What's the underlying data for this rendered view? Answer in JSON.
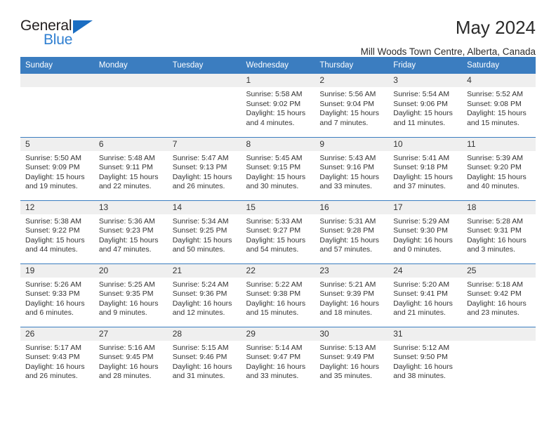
{
  "brand": {
    "name_top": "General",
    "name_bottom": "Blue",
    "triangle_color": "#1b6ec2",
    "text_color": "#231f20",
    "blue_text_color": "#2f7fd1"
  },
  "header": {
    "title": "May 2024",
    "subtitle": "Mill Woods Town Centre, Alberta, Canada"
  },
  "theme": {
    "header_bg": "#3b7dc0",
    "header_text": "#ffffff",
    "daynum_bg": "#efefef",
    "cell_text": "#333333",
    "row_divider": "#3b7dc0"
  },
  "calendar": {
    "weekdays": [
      "Sunday",
      "Monday",
      "Tuesday",
      "Wednesday",
      "Thursday",
      "Friday",
      "Saturday"
    ],
    "labels": {
      "sunrise": "Sunrise:",
      "sunset": "Sunset:",
      "daylight": "Daylight:"
    },
    "weeks": [
      [
        {
          "day": "",
          "empty": true
        },
        {
          "day": "",
          "empty": true
        },
        {
          "day": "",
          "empty": true
        },
        {
          "day": "1",
          "sunrise": "Sunrise: 5:58 AM",
          "sunset": "Sunset: 9:02 PM",
          "daylight_1": "Daylight: 15 hours",
          "daylight_2": "and 4 minutes."
        },
        {
          "day": "2",
          "sunrise": "Sunrise: 5:56 AM",
          "sunset": "Sunset: 9:04 PM",
          "daylight_1": "Daylight: 15 hours",
          "daylight_2": "and 7 minutes."
        },
        {
          "day": "3",
          "sunrise": "Sunrise: 5:54 AM",
          "sunset": "Sunset: 9:06 PM",
          "daylight_1": "Daylight: 15 hours",
          "daylight_2": "and 11 minutes."
        },
        {
          "day": "4",
          "sunrise": "Sunrise: 5:52 AM",
          "sunset": "Sunset: 9:08 PM",
          "daylight_1": "Daylight: 15 hours",
          "daylight_2": "and 15 minutes."
        }
      ],
      [
        {
          "day": "5",
          "sunrise": "Sunrise: 5:50 AM",
          "sunset": "Sunset: 9:09 PM",
          "daylight_1": "Daylight: 15 hours",
          "daylight_2": "and 19 minutes."
        },
        {
          "day": "6",
          "sunrise": "Sunrise: 5:48 AM",
          "sunset": "Sunset: 9:11 PM",
          "daylight_1": "Daylight: 15 hours",
          "daylight_2": "and 22 minutes."
        },
        {
          "day": "7",
          "sunrise": "Sunrise: 5:47 AM",
          "sunset": "Sunset: 9:13 PM",
          "daylight_1": "Daylight: 15 hours",
          "daylight_2": "and 26 minutes."
        },
        {
          "day": "8",
          "sunrise": "Sunrise: 5:45 AM",
          "sunset": "Sunset: 9:15 PM",
          "daylight_1": "Daylight: 15 hours",
          "daylight_2": "and 30 minutes."
        },
        {
          "day": "9",
          "sunrise": "Sunrise: 5:43 AM",
          "sunset": "Sunset: 9:16 PM",
          "daylight_1": "Daylight: 15 hours",
          "daylight_2": "and 33 minutes."
        },
        {
          "day": "10",
          "sunrise": "Sunrise: 5:41 AM",
          "sunset": "Sunset: 9:18 PM",
          "daylight_1": "Daylight: 15 hours",
          "daylight_2": "and 37 minutes."
        },
        {
          "day": "11",
          "sunrise": "Sunrise: 5:39 AM",
          "sunset": "Sunset: 9:20 PM",
          "daylight_1": "Daylight: 15 hours",
          "daylight_2": "and 40 minutes."
        }
      ],
      [
        {
          "day": "12",
          "sunrise": "Sunrise: 5:38 AM",
          "sunset": "Sunset: 9:22 PM",
          "daylight_1": "Daylight: 15 hours",
          "daylight_2": "and 44 minutes."
        },
        {
          "day": "13",
          "sunrise": "Sunrise: 5:36 AM",
          "sunset": "Sunset: 9:23 PM",
          "daylight_1": "Daylight: 15 hours",
          "daylight_2": "and 47 minutes."
        },
        {
          "day": "14",
          "sunrise": "Sunrise: 5:34 AM",
          "sunset": "Sunset: 9:25 PM",
          "daylight_1": "Daylight: 15 hours",
          "daylight_2": "and 50 minutes."
        },
        {
          "day": "15",
          "sunrise": "Sunrise: 5:33 AM",
          "sunset": "Sunset: 9:27 PM",
          "daylight_1": "Daylight: 15 hours",
          "daylight_2": "and 54 minutes."
        },
        {
          "day": "16",
          "sunrise": "Sunrise: 5:31 AM",
          "sunset": "Sunset: 9:28 PM",
          "daylight_1": "Daylight: 15 hours",
          "daylight_2": "and 57 minutes."
        },
        {
          "day": "17",
          "sunrise": "Sunrise: 5:29 AM",
          "sunset": "Sunset: 9:30 PM",
          "daylight_1": "Daylight: 16 hours",
          "daylight_2": "and 0 minutes."
        },
        {
          "day": "18",
          "sunrise": "Sunrise: 5:28 AM",
          "sunset": "Sunset: 9:31 PM",
          "daylight_1": "Daylight: 16 hours",
          "daylight_2": "and 3 minutes."
        }
      ],
      [
        {
          "day": "19",
          "sunrise": "Sunrise: 5:26 AM",
          "sunset": "Sunset: 9:33 PM",
          "daylight_1": "Daylight: 16 hours",
          "daylight_2": "and 6 minutes."
        },
        {
          "day": "20",
          "sunrise": "Sunrise: 5:25 AM",
          "sunset": "Sunset: 9:35 PM",
          "daylight_1": "Daylight: 16 hours",
          "daylight_2": "and 9 minutes."
        },
        {
          "day": "21",
          "sunrise": "Sunrise: 5:24 AM",
          "sunset": "Sunset: 9:36 PM",
          "daylight_1": "Daylight: 16 hours",
          "daylight_2": "and 12 minutes."
        },
        {
          "day": "22",
          "sunrise": "Sunrise: 5:22 AM",
          "sunset": "Sunset: 9:38 PM",
          "daylight_1": "Daylight: 16 hours",
          "daylight_2": "and 15 minutes."
        },
        {
          "day": "23",
          "sunrise": "Sunrise: 5:21 AM",
          "sunset": "Sunset: 9:39 PM",
          "daylight_1": "Daylight: 16 hours",
          "daylight_2": "and 18 minutes."
        },
        {
          "day": "24",
          "sunrise": "Sunrise: 5:20 AM",
          "sunset": "Sunset: 9:41 PM",
          "daylight_1": "Daylight: 16 hours",
          "daylight_2": "and 21 minutes."
        },
        {
          "day": "25",
          "sunrise": "Sunrise: 5:18 AM",
          "sunset": "Sunset: 9:42 PM",
          "daylight_1": "Daylight: 16 hours",
          "daylight_2": "and 23 minutes."
        }
      ],
      [
        {
          "day": "26",
          "sunrise": "Sunrise: 5:17 AM",
          "sunset": "Sunset: 9:43 PM",
          "daylight_1": "Daylight: 16 hours",
          "daylight_2": "and 26 minutes."
        },
        {
          "day": "27",
          "sunrise": "Sunrise: 5:16 AM",
          "sunset": "Sunset: 9:45 PM",
          "daylight_1": "Daylight: 16 hours",
          "daylight_2": "and 28 minutes."
        },
        {
          "day": "28",
          "sunrise": "Sunrise: 5:15 AM",
          "sunset": "Sunset: 9:46 PM",
          "daylight_1": "Daylight: 16 hours",
          "daylight_2": "and 31 minutes."
        },
        {
          "day": "29",
          "sunrise": "Sunrise: 5:14 AM",
          "sunset": "Sunset: 9:47 PM",
          "daylight_1": "Daylight: 16 hours",
          "daylight_2": "and 33 minutes."
        },
        {
          "day": "30",
          "sunrise": "Sunrise: 5:13 AM",
          "sunset": "Sunset: 9:49 PM",
          "daylight_1": "Daylight: 16 hours",
          "daylight_2": "and 35 minutes."
        },
        {
          "day": "31",
          "sunrise": "Sunrise: 5:12 AM",
          "sunset": "Sunset: 9:50 PM",
          "daylight_1": "Daylight: 16 hours",
          "daylight_2": "and 38 minutes."
        },
        {
          "day": "",
          "empty": true
        }
      ]
    ]
  }
}
